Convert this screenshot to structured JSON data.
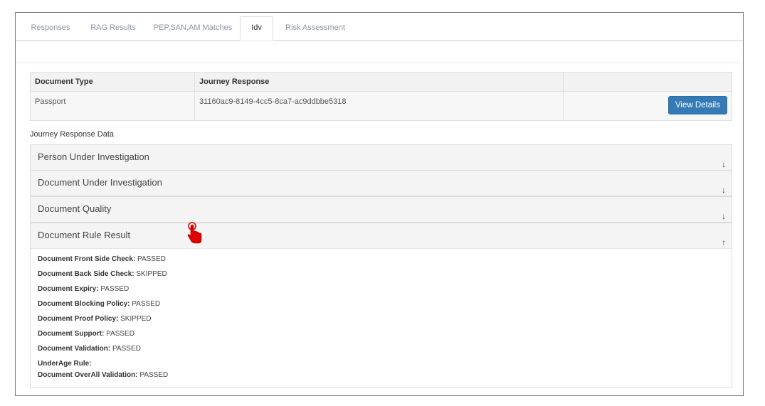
{
  "tabs": [
    {
      "label": "Responses",
      "active": false
    },
    {
      "label": "RAG Results",
      "active": false
    },
    {
      "label": "PEP,SAN,AM Matches",
      "active": false
    },
    {
      "label": "Idv",
      "active": true
    },
    {
      "label": "Risk Assessment",
      "active": false
    }
  ],
  "documents_table": {
    "headers": [
      "Document Type",
      "Journey Response",
      ""
    ],
    "rows": [
      {
        "type": "Passport",
        "journey_response": "31160ac9-8149-4cc5-8ca7-ac9ddbbe5318",
        "action_label": "View Details"
      }
    ]
  },
  "journey_section_label": "Journey Response Data",
  "accordions": [
    {
      "title": "Person Under Investigation",
      "arrow": "↓",
      "expanded": false
    },
    {
      "title": "Document Under Investigation",
      "arrow": "↓",
      "expanded": false
    },
    {
      "title": "Document Quality",
      "arrow": "↓",
      "expanded": false
    },
    {
      "title": "Document Rule Result",
      "arrow": "↑",
      "expanded": true
    }
  ],
  "rule_results": [
    {
      "label": "Document Front Side Check:",
      "value": "PASSED"
    },
    {
      "label": "Document Back Side Check:",
      "value": "SKIPPED"
    },
    {
      "label": "Document Expiry:",
      "value": "PASSED"
    },
    {
      "label": "Document Blocking Policy:",
      "value": "PASSED"
    },
    {
      "label": "Document Proof Policy:",
      "value": "SKIPPED"
    },
    {
      "label": "Document Support:",
      "value": "PASSED"
    },
    {
      "label": "Document Validation:",
      "value": "PASSED"
    },
    {
      "label": "UnderAge Rule:",
      "value": ""
    },
    {
      "label": "Document OverAll Validation:",
      "value": "PASSED"
    }
  ],
  "colors": {
    "primary_button": "#337ab7",
    "cursor": "#e00000"
  },
  "icons": {
    "pointer": "hand-pointer-icon"
  }
}
